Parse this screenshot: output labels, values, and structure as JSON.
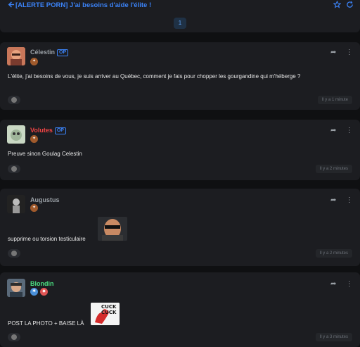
{
  "header": {
    "back_icon": "arrow-left-icon",
    "title": "[ALERTE PORN] J'ai besoins d'aide l'élite !",
    "star_icon": "star-icon",
    "refresh_icon": "refresh-icon",
    "current_page": "1"
  },
  "posts": [
    {
      "author": "Célestin",
      "author_color": "#9aa0a6",
      "op_label": "OP",
      "badges": [
        "rank-badge"
      ],
      "content": "L'élite, j'ai besoins de vous, je suis arriver au Québec, comment je fais pour chopper les gourgandine qui m'héberge ?",
      "time": "Il y a 1 minute"
    },
    {
      "author": "Volutes",
      "author_color": "#ef4444",
      "op_label": "OP",
      "badges": [
        "rank-badge"
      ],
      "content": "Preuve sinon Goulag Celestin",
      "time": "Il y a 2 minutes"
    },
    {
      "author": "Augustus",
      "author_color": "#9aa0a6",
      "badges": [
        "rank-badge"
      ],
      "content": "supprime ou torsion testiculaire",
      "time": "Il y a 2 minutes"
    },
    {
      "author": "Blondin",
      "author_color": "#4ade80",
      "badges": [
        "moderator-badge",
        "shield-badge"
      ],
      "content": "POST LA PHOTO + BAISE LÀ",
      "sticker_text": "CUCK CUCK",
      "time": "Il y a 3 minutes"
    }
  ],
  "colors": {
    "accent": "#3b82f6",
    "background": "#0f1012",
    "card": "#1c1d21"
  }
}
